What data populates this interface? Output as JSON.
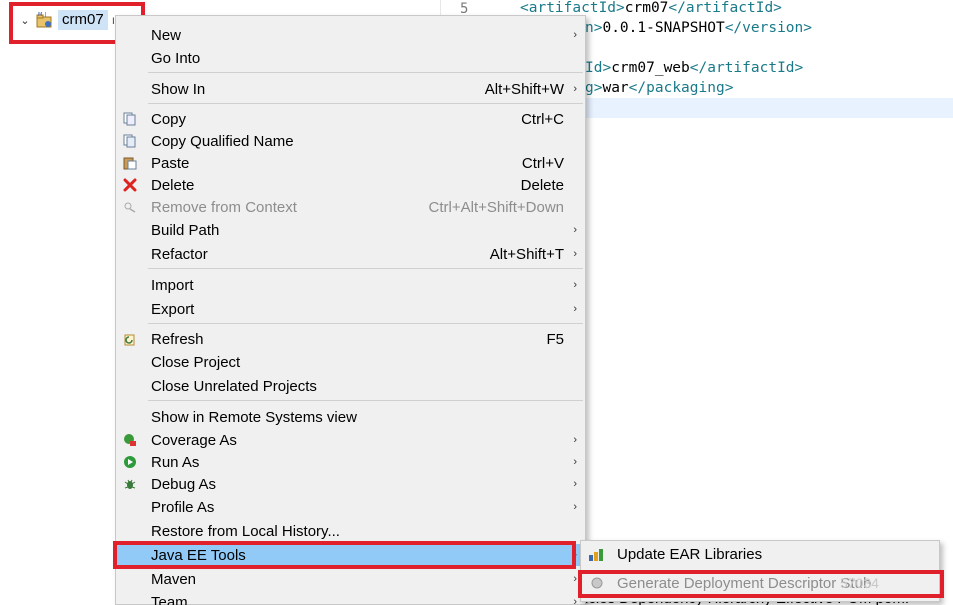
{
  "tree": {
    "project_name": "crm07",
    "extra": "ı"
  },
  "editor": {
    "line_number": "5",
    "lines": [
      {
        "open_tag": "<artifactId>",
        "text": "crm07",
        "close_tag": "</artifactId>"
      },
      {
        "open_tag": "n>",
        "text": "0.0.1-SNAPSHOT",
        "close_tag": "</version>"
      },
      {
        "open_tag": "Id>",
        "text": "crm07_web",
        "close_tag": "</artifactId>"
      },
      {
        "open_tag": "g>",
        "text": "war",
        "close_tag": "</packaging>"
      }
    ],
    "bottom_tabs": "ncies Dependency Hierarchy Effective POM pom."
  },
  "menu": {
    "items": [
      {
        "label": "New",
        "accel": "",
        "submenu": true
      },
      {
        "label": "Go Into",
        "accel": ""
      },
      {
        "label": "Show In",
        "accel": "Alt+Shift+W",
        "submenu": true
      },
      {
        "label": "Copy",
        "accel": "Ctrl+C"
      },
      {
        "label": "Copy Qualified Name",
        "accel": ""
      },
      {
        "label": "Paste",
        "accel": "Ctrl+V"
      },
      {
        "label": "Delete",
        "accel": "Delete"
      },
      {
        "label": "Remove from Context",
        "accel": "Ctrl+Alt+Shift+Down"
      },
      {
        "label": "Build Path",
        "accel": "",
        "submenu": true
      },
      {
        "label": "Refactor",
        "accel": "Alt+Shift+T",
        "submenu": true
      },
      {
        "label": "Import",
        "accel": "",
        "submenu": true
      },
      {
        "label": "Export",
        "accel": "",
        "submenu": true
      },
      {
        "label": "Refresh",
        "accel": "F5"
      },
      {
        "label": "Close Project",
        "accel": ""
      },
      {
        "label": "Close Unrelated Projects",
        "accel": ""
      },
      {
        "label": "Show in Remote Systems view",
        "accel": ""
      },
      {
        "label": "Coverage As",
        "accel": "",
        "submenu": true
      },
      {
        "label": "Run As",
        "accel": "",
        "submenu": true
      },
      {
        "label": "Debug As",
        "accel": "",
        "submenu": true
      },
      {
        "label": "Profile As",
        "accel": "",
        "submenu": true
      },
      {
        "label": "Restore from Local History...",
        "accel": ""
      },
      {
        "label": "Java EE Tools",
        "accel": "",
        "submenu": true
      },
      {
        "label": "Maven",
        "accel": "",
        "submenu": true
      },
      {
        "label": "Team",
        "accel": "",
        "submenu": true
      }
    ]
  },
  "submenu": {
    "items": [
      {
        "label": "Update EAR Libraries"
      },
      {
        "label": "Generate Deployment Descriptor Stub"
      }
    ]
  },
  "arrow_glyph": "›",
  "twisty_glyph": "⌄",
  "colors": {
    "highlight": "#91c9f7",
    "annotation_red": "#e0202a",
    "xml_tag": "#1a7a8a",
    "disabled": "#8d8d8d"
  },
  "watermark": "57034"
}
